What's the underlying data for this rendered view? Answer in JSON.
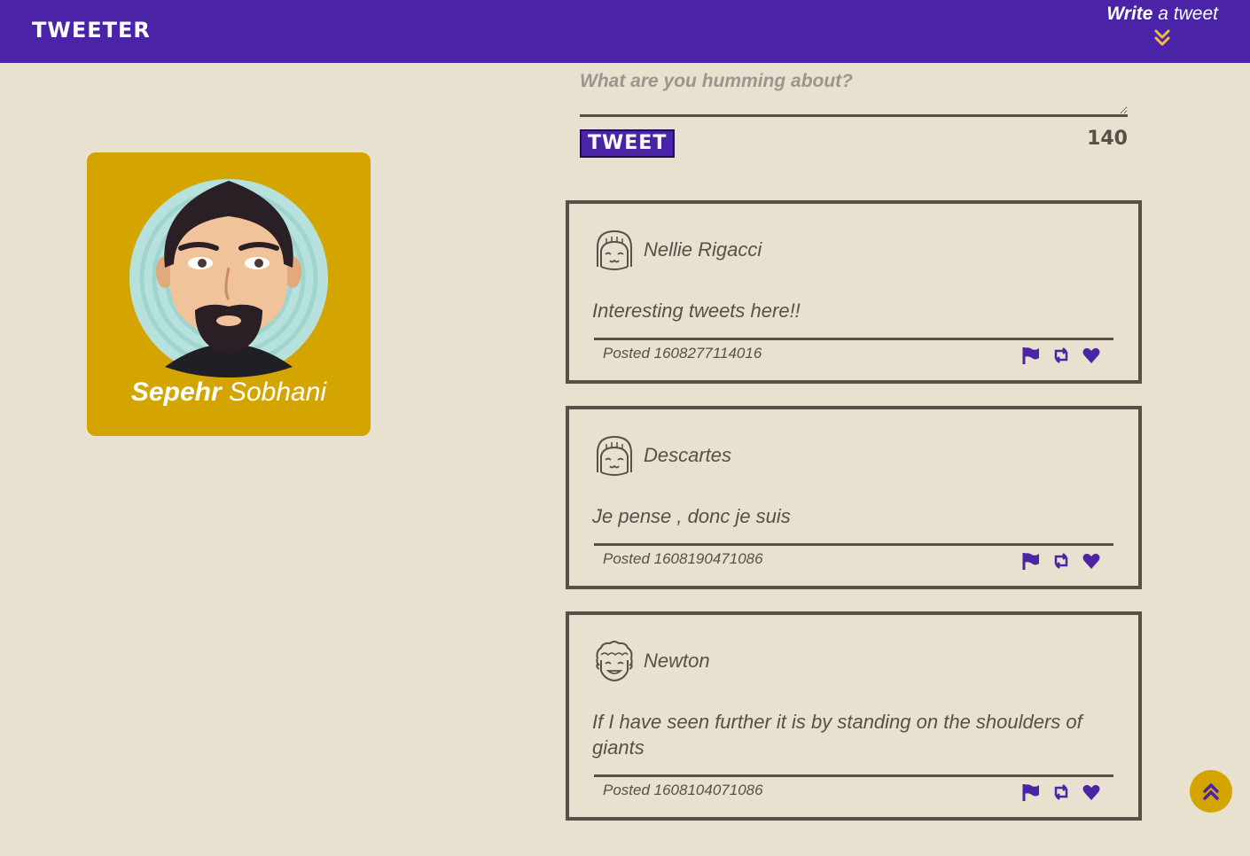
{
  "nav": {
    "brand": "TWEETER",
    "write_bold": "Write",
    "write_rest": " a tweet",
    "chevron_icon": "double-chevron-down-icon",
    "chevron_color": "#f3b94a"
  },
  "profile": {
    "first_name": "Sepehr",
    "last_name": " Sobhani",
    "avatar_icon": "bearded-man-avatar",
    "card_color": "#d4a500"
  },
  "composer": {
    "placeholder": "What are you humming about?",
    "value": "",
    "button_label": "TWEET",
    "counter": "140"
  },
  "tweets": [
    {
      "name": "Nellie Rigacci",
      "avatar_icon": "girl-face-icon",
      "text": "Interesting tweets here!!",
      "posted": "Posted 1608277114016"
    },
    {
      "name": "Descartes",
      "avatar_icon": "girl-face-icon",
      "text": "Je pense , donc je suis",
      "posted": "Posted 1608190471086"
    },
    {
      "name": "Newton",
      "avatar_icon": "curly-hair-face-icon",
      "text": "If I have seen further it is by standing on the shoulders of giants",
      "posted": "Posted 1608104071086"
    }
  ],
  "actions": {
    "flag_icon": "flag-icon",
    "retweet_icon": "retweet-icon",
    "like_icon": "heart-icon",
    "color": "#4a23a6"
  },
  "scroll_top": {
    "icon": "double-chevron-up-icon"
  },
  "colors": {
    "nav_bg": "#4a23a6",
    "page_bg": "#e8e1cf",
    "text": "#545149",
    "accent": "#d4a500"
  }
}
